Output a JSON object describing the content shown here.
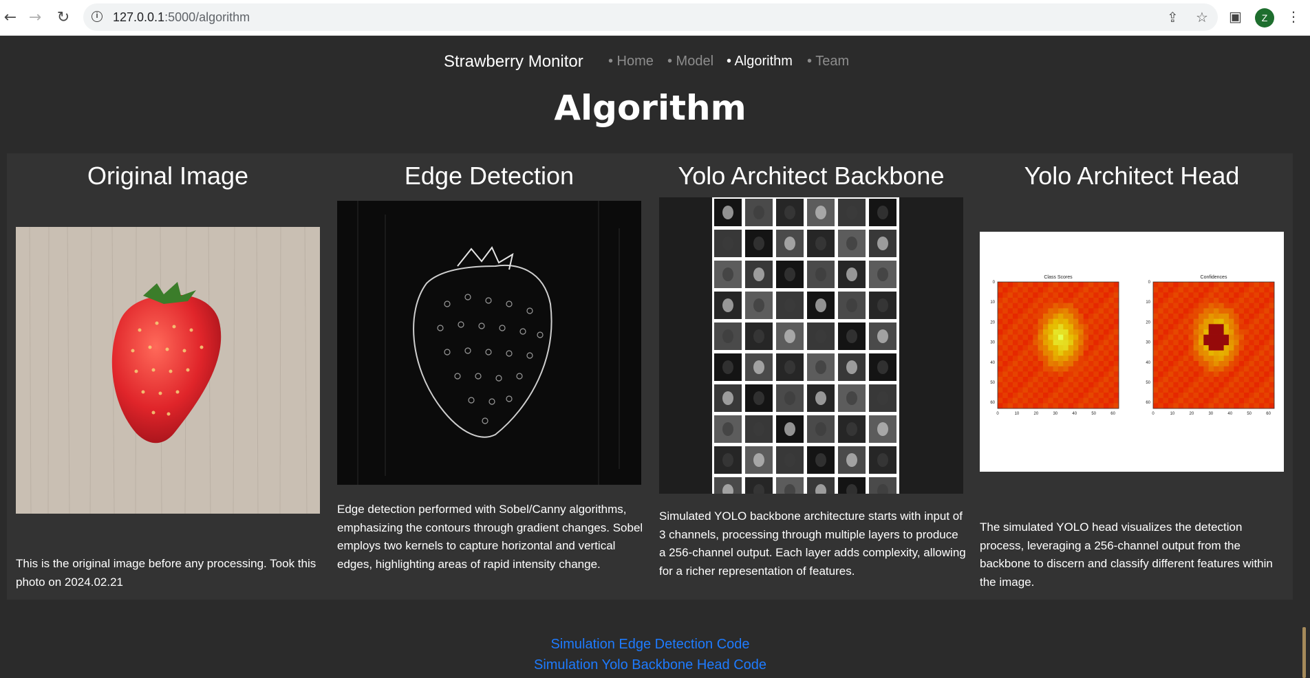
{
  "browser": {
    "url_host": "127.0.0.1",
    "url_path": ":5000/algorithm",
    "profile_initial": "Z",
    "back_icon": "arrow-left-icon",
    "forward_icon": "arrow-right-icon",
    "reload_icon": "reload-icon"
  },
  "site": {
    "brand": "Strawberry Monitor",
    "nav": [
      {
        "label": "• Home",
        "active": false
      },
      {
        "label": "• Model",
        "active": false
      },
      {
        "label": "• Algorithm",
        "active": true
      },
      {
        "label": "• Team",
        "active": false
      }
    ]
  },
  "page": {
    "title": "Algorithm"
  },
  "cards": [
    {
      "title": "Original Image",
      "text": "This is the original image before any processing. Took this photo on 2024.02.21"
    },
    {
      "title": "Edge Detection",
      "text": "Edge detection performed with Sobel/Canny algorithms, emphasizing the contours through gradient changes. Sobel employs two kernels to capture horizontal and vertical edges, highlighting areas of rapid intensity change."
    },
    {
      "title": "Yolo Architect Backbone",
      "text": "Simulated YOLO backbone architecture starts with input of 3 channels, processing through multiple layers to produce a 256-channel output. Each layer adds complexity, allowing for a richer representation of features."
    },
    {
      "title": "Yolo Architect Head",
      "text": "The simulated YOLO head visualizes the detection process, leveraging a 256-channel output from the backbone to discern and classify different features within the image.",
      "plot_titles": [
        "Class Scores",
        "Confidences"
      ],
      "y_ticks": [
        "0",
        "10",
        "20",
        "30",
        "40",
        "50",
        "60"
      ],
      "x_ticks": [
        "0",
        "10",
        "20",
        "30",
        "40",
        "50",
        "60"
      ]
    }
  ],
  "links": {
    "edge_code": "Simulation Edge Detection Code",
    "yolo_code": "Simulation Yolo Backbone Head Code"
  },
  "colors": {
    "background": "#2b2b2b",
    "card_bg": "#333333",
    "link": "#1e7bff"
  }
}
